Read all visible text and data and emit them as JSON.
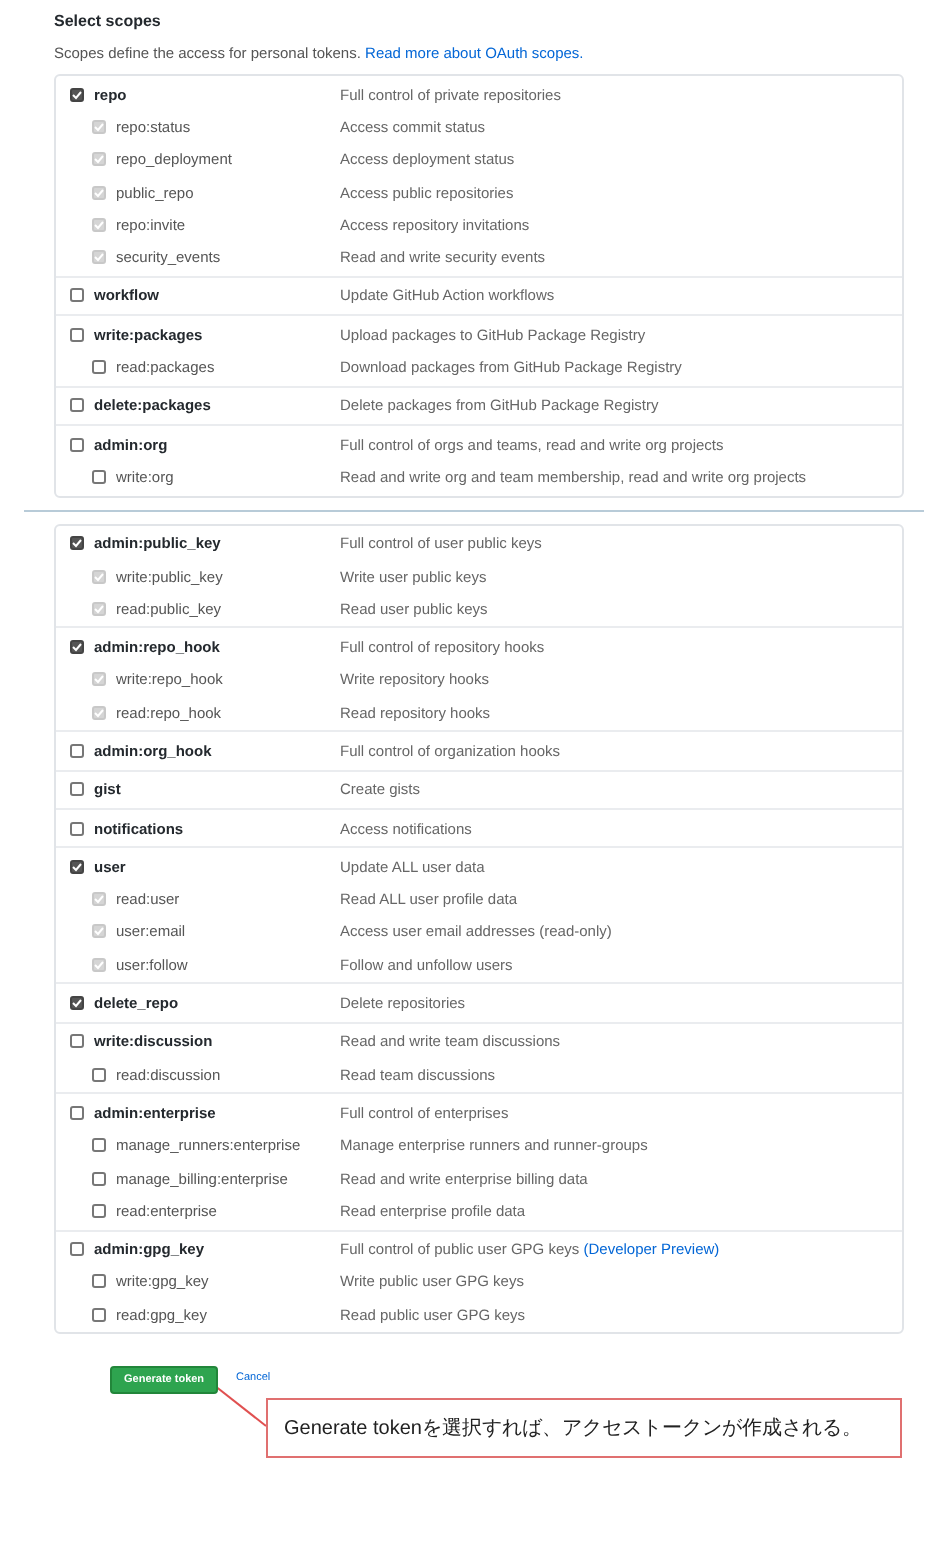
{
  "header": {
    "title": "Select scopes",
    "description": "Scopes define the access for personal tokens.",
    "link": "Read more about OAuth scopes."
  },
  "panels": [
    {
      "groups": [
        {
          "scope": {
            "name": "repo",
            "description": "Full control of private repositories",
            "checked": true,
            "disabled": false
          },
          "children": [
            {
              "name": "repo:status",
              "description": "Access commit status",
              "checked": true,
              "disabled": true
            },
            {
              "name": "repo_deployment",
              "description": "Access deployment status",
              "checked": true,
              "disabled": true
            },
            {
              "name": "public_repo",
              "description": "Access public repositories",
              "checked": true,
              "disabled": true
            },
            {
              "name": "repo:invite",
              "description": "Access repository invitations",
              "checked": true,
              "disabled": true
            },
            {
              "name": "security_events",
              "description": "Read and write security events",
              "checked": true,
              "disabled": true
            }
          ]
        },
        {
          "scope": {
            "name": "workflow",
            "description": "Update GitHub Action workflows",
            "checked": false,
            "disabled": false
          }
        },
        {
          "scope": {
            "name": "write:packages",
            "description": "Upload packages to GitHub Package Registry",
            "checked": false,
            "disabled": false
          },
          "children": [
            {
              "name": "read:packages",
              "description": "Download packages from GitHub Package Registry",
              "checked": false,
              "disabled": false
            }
          ]
        },
        {
          "scope": {
            "name": "delete:packages",
            "description": "Delete packages from GitHub Package Registry",
            "checked": false,
            "disabled": false
          }
        },
        {
          "scope": {
            "name": "admin:org",
            "description": "Full control of orgs and teams, read and write org projects",
            "checked": false,
            "disabled": false
          },
          "children": [
            {
              "name": "write:org",
              "description": "Read and write org and team membership, read and write org projects",
              "checked": false,
              "disabled": false
            }
          ]
        }
      ]
    },
    {
      "groups": [
        {
          "scope": {
            "name": "admin:public_key",
            "description": "Full control of user public keys",
            "checked": true,
            "disabled": false
          },
          "children": [
            {
              "name": "write:public_key",
              "description": "Write user public keys",
              "checked": true,
              "disabled": true
            },
            {
              "name": "read:public_key",
              "description": "Read user public keys",
              "checked": true,
              "disabled": true
            }
          ]
        },
        {
          "scope": {
            "name": "admin:repo_hook",
            "description": "Full control of repository hooks",
            "checked": true,
            "disabled": false
          },
          "children": [
            {
              "name": "write:repo_hook",
              "description": "Write repository hooks",
              "checked": true,
              "disabled": true
            },
            {
              "name": "read:repo_hook",
              "description": "Read repository hooks",
              "checked": true,
              "disabled": true
            }
          ]
        },
        {
          "scope": {
            "name": "admin:org_hook",
            "description": "Full control of organization hooks",
            "checked": false,
            "disabled": false
          }
        },
        {
          "scope": {
            "name": "gist",
            "description": "Create gists",
            "checked": false,
            "disabled": false
          }
        },
        {
          "scope": {
            "name": "notifications",
            "description": "Access notifications",
            "checked": false,
            "disabled": false
          }
        },
        {
          "scope": {
            "name": "user",
            "description": "Update ALL user data",
            "checked": true,
            "disabled": false
          },
          "children": [
            {
              "name": "read:user",
              "description": "Read ALL user profile data",
              "checked": true,
              "disabled": true
            },
            {
              "name": "user:email",
              "description": "Access user email addresses (read-only)",
              "checked": true,
              "disabled": true
            },
            {
              "name": "user:follow",
              "description": "Follow and unfollow users",
              "checked": true,
              "disabled": true
            }
          ]
        },
        {
          "scope": {
            "name": "delete_repo",
            "description": "Delete repositories",
            "checked": true,
            "disabled": false
          }
        },
        {
          "scope": {
            "name": "write:discussion",
            "description": "Read and write team discussions",
            "checked": false,
            "disabled": false
          },
          "children": [
            {
              "name": "read:discussion",
              "description": "Read team discussions",
              "checked": false,
              "disabled": false
            }
          ]
        },
        {
          "scope": {
            "name": "admin:enterprise",
            "description": "Full control of enterprises",
            "checked": false,
            "disabled": false
          },
          "children": [
            {
              "name": "manage_runners:enterprise",
              "description": "Manage enterprise runners and runner-groups",
              "checked": false,
              "disabled": false
            },
            {
              "name": "manage_billing:enterprise",
              "description": "Read and write enterprise billing data",
              "checked": false,
              "disabled": false
            },
            {
              "name": "read:enterprise",
              "description": "Read enterprise profile data",
              "checked": false,
              "disabled": false
            }
          ]
        },
        {
          "scope": {
            "name": "admin:gpg_key",
            "description": "Full control of public user GPG keys",
            "link": "(Developer Preview)",
            "checked": false,
            "disabled": false
          },
          "children": [
            {
              "name": "write:gpg_key",
              "description": "Write public user GPG keys",
              "checked": false,
              "disabled": false
            },
            {
              "name": "read:gpg_key",
              "description": "Read public user GPG keys",
              "checked": false,
              "disabled": false
            }
          ]
        }
      ]
    }
  ],
  "footer": {
    "button": "Generate token",
    "cancel": "Cancel",
    "callout": "Generate tokenを選択すれば、アクセストークンが作成される。"
  }
}
